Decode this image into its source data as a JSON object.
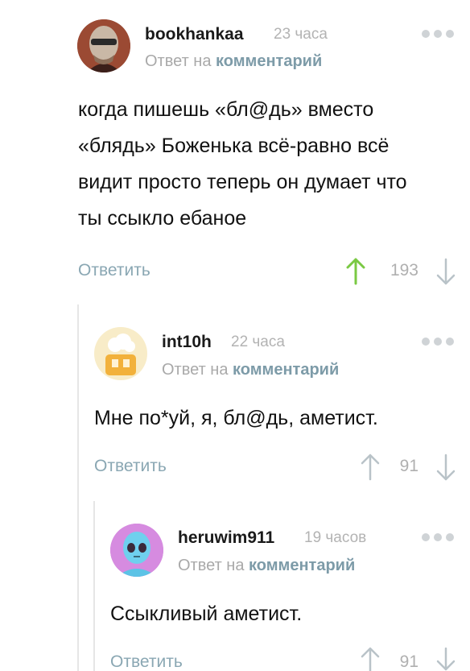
{
  "comments": [
    {
      "username": "bookhankaa",
      "time": "23 часа",
      "reply_prefix": "Ответ на",
      "reply_link": "комментарий",
      "text": "когда пишешь «бл@дь» вместо «блядь» Боженька всё-равно всё видит просто теперь он думает что ты ссыкло ебаное",
      "reply_label": "Ответить",
      "rating": "193",
      "upvote_active": true
    },
    {
      "username": "int10h",
      "time": "22 часа",
      "reply_prefix": "Ответ на",
      "reply_link": "комментарий",
      "text": "Мне по*уй, я, бл@дь, аметист.",
      "reply_label": "Ответить",
      "rating": "91",
      "upvote_active": false
    },
    {
      "username": "heruwim911",
      "time": "19 часов",
      "reply_prefix": "Ответ на",
      "reply_link": "комментарий",
      "text": "Ссыкливый аметист.",
      "reply_label": "Ответить",
      "rating": "91",
      "upvote_active": false
    }
  ],
  "colors": {
    "upvote_active": "#7ac943",
    "vote_inactive": "#b9c3c8",
    "link": "#7d9ba8",
    "reply": "#8aa7b3"
  },
  "icons": [
    "more-dots-icon",
    "upvote-arrow-icon",
    "downvote-arrow-icon"
  ]
}
